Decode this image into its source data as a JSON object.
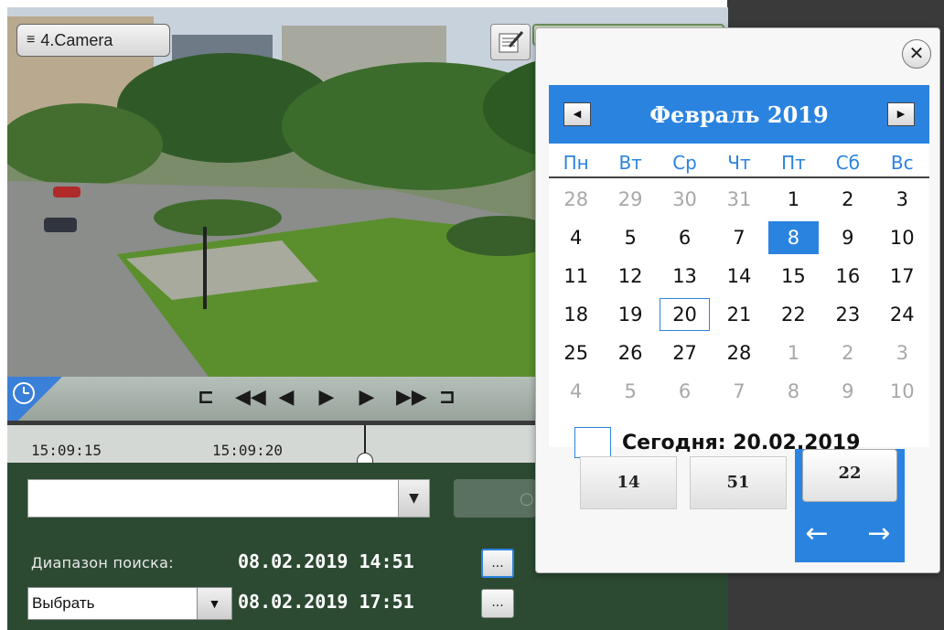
{
  "camera": {
    "label": "4.Camera"
  },
  "timeline": {
    "ticks": [
      "15:09:15",
      "15:09:20"
    ]
  },
  "search": {
    "range_label": "Диапазон поиска:",
    "from_value": "08.02.2019 14:51",
    "to_value": "08.02.2019 17:51",
    "dots_label": "...",
    "select_value": "Выбрать"
  },
  "calendar": {
    "title": "Февраль 2019",
    "weekdays": [
      "Пн",
      "Вт",
      "Ср",
      "Чт",
      "Пт",
      "Сб",
      "Вс"
    ],
    "weeks": [
      [
        "28",
        "29",
        "30",
        "31",
        "1",
        "2",
        "3"
      ],
      [
        "4",
        "5",
        "6",
        "7",
        "8",
        "9",
        "10"
      ],
      [
        "11",
        "12",
        "13",
        "14",
        "15",
        "16",
        "17"
      ],
      [
        "18",
        "19",
        "20",
        "21",
        "22",
        "23",
        "24"
      ],
      [
        "25",
        "26",
        "27",
        "28",
        "1",
        "2",
        "3"
      ],
      [
        "4",
        "5",
        "6",
        "7",
        "8",
        "9",
        "10"
      ]
    ],
    "today_label": "Сегодня: 20.02.2019"
  },
  "time": {
    "hours": "14",
    "minutes": "51",
    "seconds": "22"
  },
  "colors": {
    "accent": "#2b83e0",
    "panel_green": "#2c4a32"
  }
}
